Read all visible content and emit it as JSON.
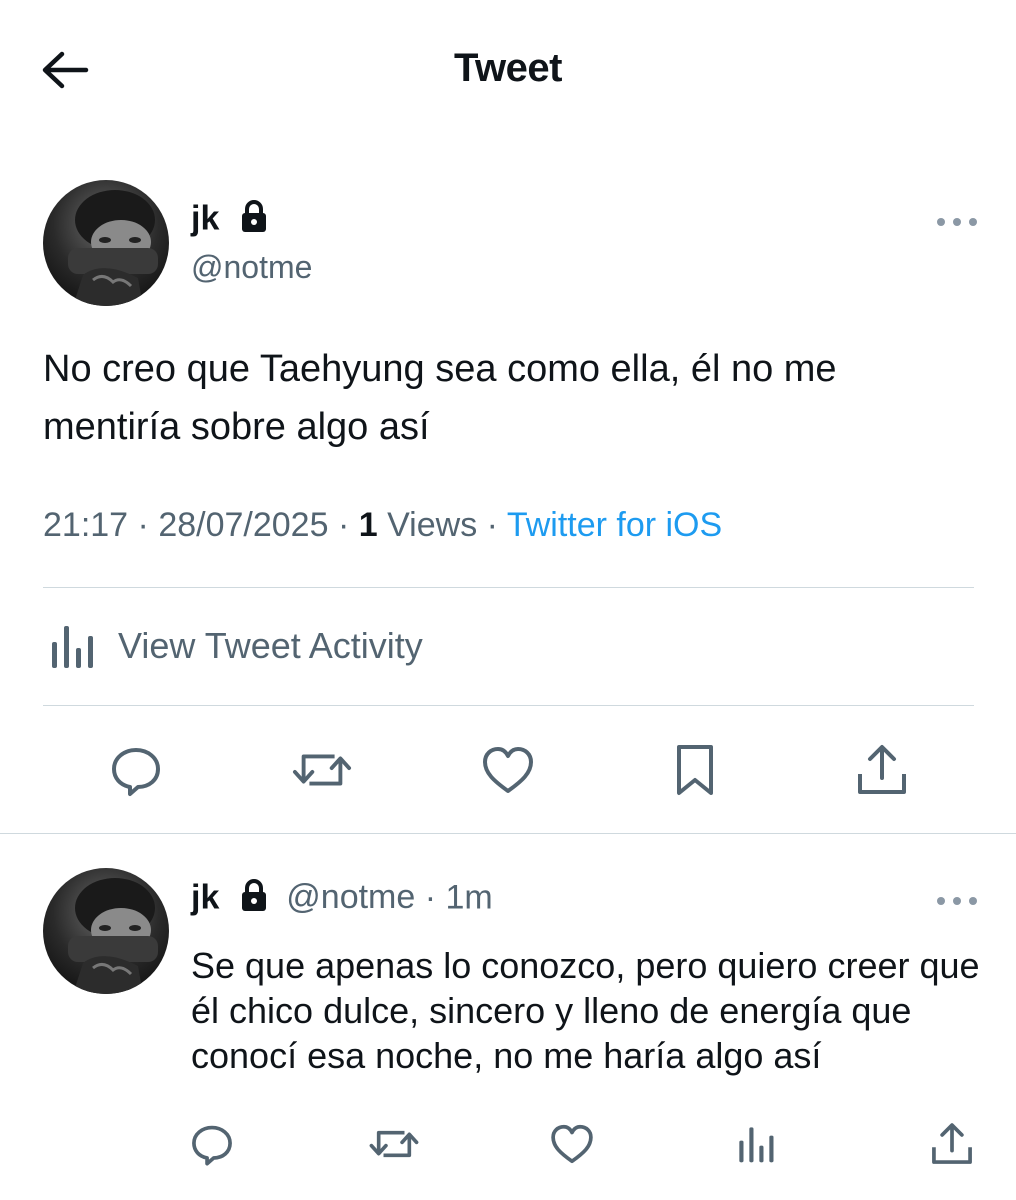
{
  "header": {
    "title": "Tweet"
  },
  "tweet": {
    "display_name": "jk",
    "handle": "@notme",
    "text": "No creo que Taehyung sea como ella, él no me mentiría sobre algo así",
    "time": "21:17",
    "date": "28/07/2025",
    "views_count": "1",
    "views_label": "Views",
    "source": "Twitter for iOS",
    "activity_label": "View Tweet Activity"
  },
  "reply": {
    "display_name": "jk",
    "handle": "@notme",
    "age": "1m",
    "text": "Se que apenas lo conozco, pero quiero creer que él chico dulce, sincero y lleno de energía que conocí esa noche, no me haría algo así"
  },
  "colors": {
    "text_primary": "#0f1419",
    "text_secondary": "#536471",
    "link": "#1d9bf0",
    "divider": "#cfd9de"
  },
  "icons": {
    "back": "arrow-left-icon",
    "lock": "lock-icon",
    "more": "more-icon",
    "activity": "bar-chart-icon",
    "reply": "reply-icon",
    "retweet": "retweet-icon",
    "like": "heart-icon",
    "bookmark": "bookmark-icon",
    "share": "share-icon"
  }
}
